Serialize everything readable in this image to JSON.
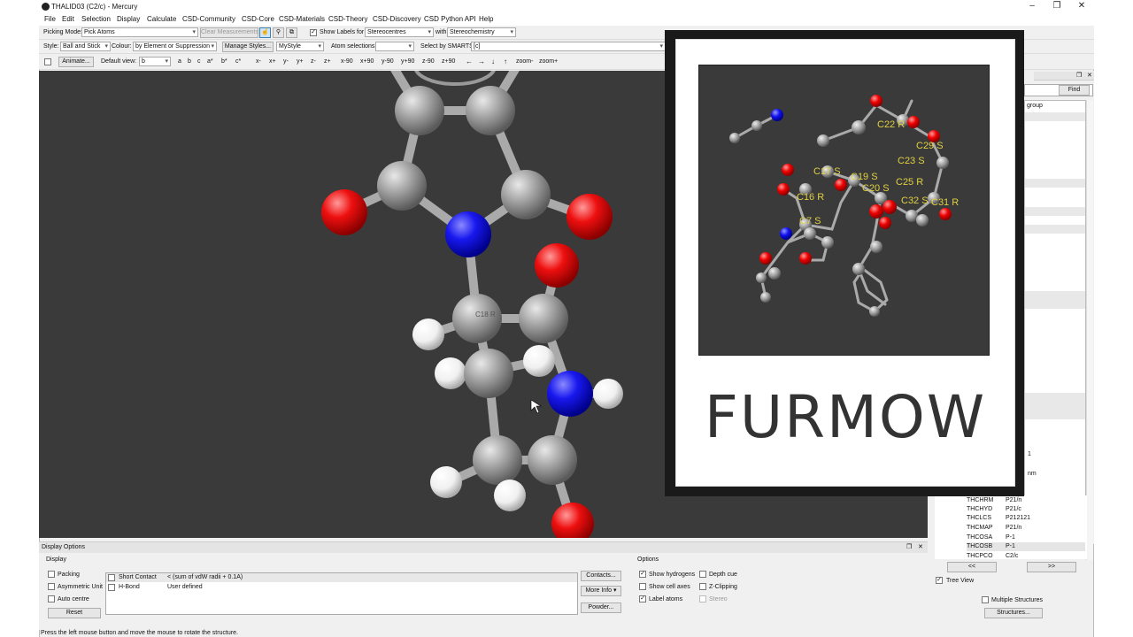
{
  "window": {
    "title": "THALID03 (C2/c) - Mercury"
  },
  "menu": [
    "File",
    "Edit",
    "Selection",
    "Display",
    "Calculate",
    "CSD-Community",
    "CSD-Core",
    "CSD-Materials",
    "CSD-Theory",
    "CSD-Discovery",
    "CSD Python API",
    "Help"
  ],
  "toolbar1": {
    "picking_mode_label": "Picking Mode:",
    "picking_mode_value": "Pick Atoms",
    "clear_measurements": "Clear Measurements",
    "show_labels_for": "Show Labels for",
    "labels_value": "Stereocentres",
    "with_label": "with",
    "with_value": "Stereochemistry"
  },
  "toolbar2": {
    "style_label": "Style:",
    "style_value": "Ball and Stick",
    "colour_label": "Colour:",
    "colour_value": "by Element or Suppression",
    "manage_styles": "Manage Styles...",
    "style_name": "MyStyle",
    "atom_selections_label": "Atom selections:",
    "smarts_label": "Select by SMARTS:",
    "smarts_value": "[c]"
  },
  "toolbar3": {
    "animate": "Animate...",
    "default_view_label": "Default view:",
    "default_view_value": "b",
    "views": [
      "a",
      "b",
      "c",
      "a*",
      "b*",
      "c*"
    ],
    "rotations": [
      "x-",
      "x+",
      "y-",
      "y+",
      "z-",
      "z+",
      "x-90",
      "x+90",
      "y-90",
      "y+90",
      "z-90",
      "z+90"
    ],
    "arrows": [
      "←",
      "→",
      "↓",
      "↑"
    ],
    "zoom": [
      "zoom-",
      "zoom+"
    ]
  },
  "viewer": {
    "atom_label": "C18 R"
  },
  "card": {
    "title": "FURMOW",
    "labels": [
      "C22 R",
      "C29 S",
      "C23 S",
      "C17 S",
      "C19 S",
      "C20 S",
      "C25 R",
      "C16 R",
      "C32 S",
      "C31 R",
      "C7 S"
    ]
  },
  "right_panel": {
    "find": "Find",
    "group_header": "group",
    "frag1": "1",
    "frag2": "nm",
    "rows": [
      {
        "refcode": "THCHRM",
        "sg": "P21/n"
      },
      {
        "refcode": "THCHYD",
        "sg": "P21/c"
      },
      {
        "refcode": "THCLCS",
        "sg": "P212121"
      },
      {
        "refcode": "THCMAP",
        "sg": "P21/n"
      },
      {
        "refcode": "THCOSA",
        "sg": "P-1"
      },
      {
        "refcode": "THCOSB",
        "sg": "P-1"
      },
      {
        "refcode": "THCPCO",
        "sg": "C2/c"
      }
    ],
    "prev": "<<",
    "next": ">>",
    "tree_view": "Tree View",
    "multiple_structures": "Multiple Structures",
    "structures_btn": "Structures..."
  },
  "display_options": {
    "header": "Display Options",
    "display_group": "Display",
    "packing": "Packing",
    "asym_unit": "Asymmetric Unit",
    "auto_centre": "Auto centre",
    "reset": "Reset",
    "contacts": [
      {
        "name": "Short Contact",
        "desc": "< (sum of vdW radii + 0.1A)"
      },
      {
        "name": "H-Bond",
        "desc": "User defined"
      }
    ],
    "contacts_btn": "Contacts...",
    "more_info_btn": "More Info",
    "powder_btn": "Powder...",
    "options_group": "Options",
    "show_hydrogens": "Show hydrogens",
    "show_cell_axes": "Show cell axes",
    "label_atoms": "Label atoms",
    "depth_cue": "Depth cue",
    "z_clipping": "Z-Clipping",
    "stereo": "Stereo"
  },
  "status": "Press the left mouse button and move the mouse to rotate the structure."
}
